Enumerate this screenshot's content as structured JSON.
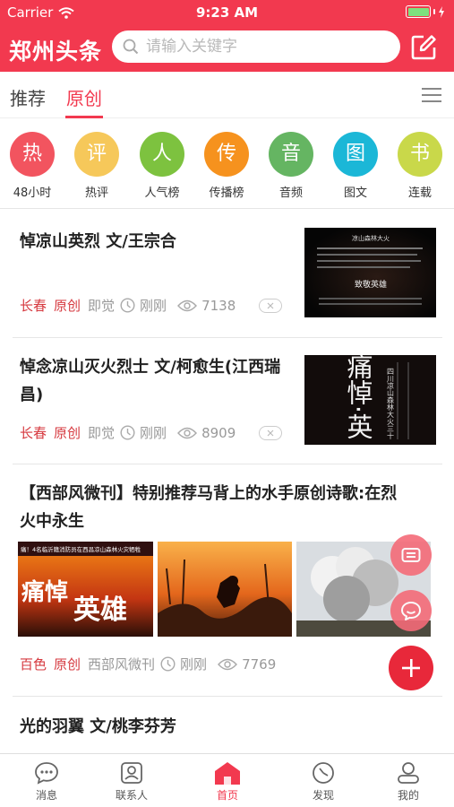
{
  "status": {
    "carrier": "Carrier",
    "time": "9:23 AM"
  },
  "header": {
    "title": "郑州头条",
    "search_placeholder": "请输入关键字"
  },
  "tabs": [
    {
      "label": "推荐"
    },
    {
      "label": "原创",
      "active": true
    }
  ],
  "categories": [
    {
      "glyph": "热",
      "label": "48小时",
      "color": "#f2545f"
    },
    {
      "glyph": "评",
      "label": "热评",
      "color": "#f6c85a"
    },
    {
      "glyph": "人",
      "label": "人气榜",
      "color": "#7dc23f"
    },
    {
      "glyph": "传",
      "label": "传播榜",
      "color": "#f6921e"
    },
    {
      "glyph": "音",
      "label": "音频",
      "color": "#65b562"
    },
    {
      "glyph": "图",
      "label": "图文",
      "color": "#1bb7d7"
    },
    {
      "glyph": "书",
      "label": "连载",
      "color": "#c9d84a"
    }
  ],
  "articles": [
    {
      "title": "悼凉山英烈 文/王宗合",
      "tags": [
        "长春",
        "原创"
      ],
      "source": "即觉",
      "time": "刚刚",
      "views": "7138",
      "thumb_text": {
        "heading": "凉山森林大火",
        "sign": "致敬英雄"
      }
    },
    {
      "title_lines": [
        "悼念凉山灭火烈士 文/柯愈生(江西瑞",
        "昌)"
      ],
      "tags": [
        "长春",
        "原创"
      ],
      "source": "即觉",
      "time": "刚刚",
      "views": "8909",
      "thumb_text": {
        "big": "痛悼·英",
        "col": "四川凉山森林大火三十"
      }
    },
    {
      "title_lines": [
        "【西部风微刊】特别推荐马背上的水手原创诗歌:在烈",
        "火中永生"
      ],
      "tags": [
        "百色",
        "原创"
      ],
      "source": "西部风微刊",
      "time": "刚刚",
      "views": "7769",
      "img1_text": {
        "banner": "痛！4名临沂籍消防员在西昌凉山森林火灾牺牲",
        "big1": "痛悼",
        "big2": "英雄"
      }
    },
    {
      "title": "光的羽翼 文/桃李芬芳"
    }
  ],
  "tabbar": [
    {
      "label": "消息",
      "icon": "message-icon"
    },
    {
      "label": "联系人",
      "icon": "contacts-icon"
    },
    {
      "label": "首页",
      "icon": "home-icon",
      "active": true
    },
    {
      "label": "发现",
      "icon": "discover-icon"
    },
    {
      "label": "我的",
      "icon": "profile-icon"
    }
  ],
  "colors": {
    "brand": "#f2394f",
    "fab_pink": "#f46b78",
    "fab_red": "#e8283a"
  }
}
